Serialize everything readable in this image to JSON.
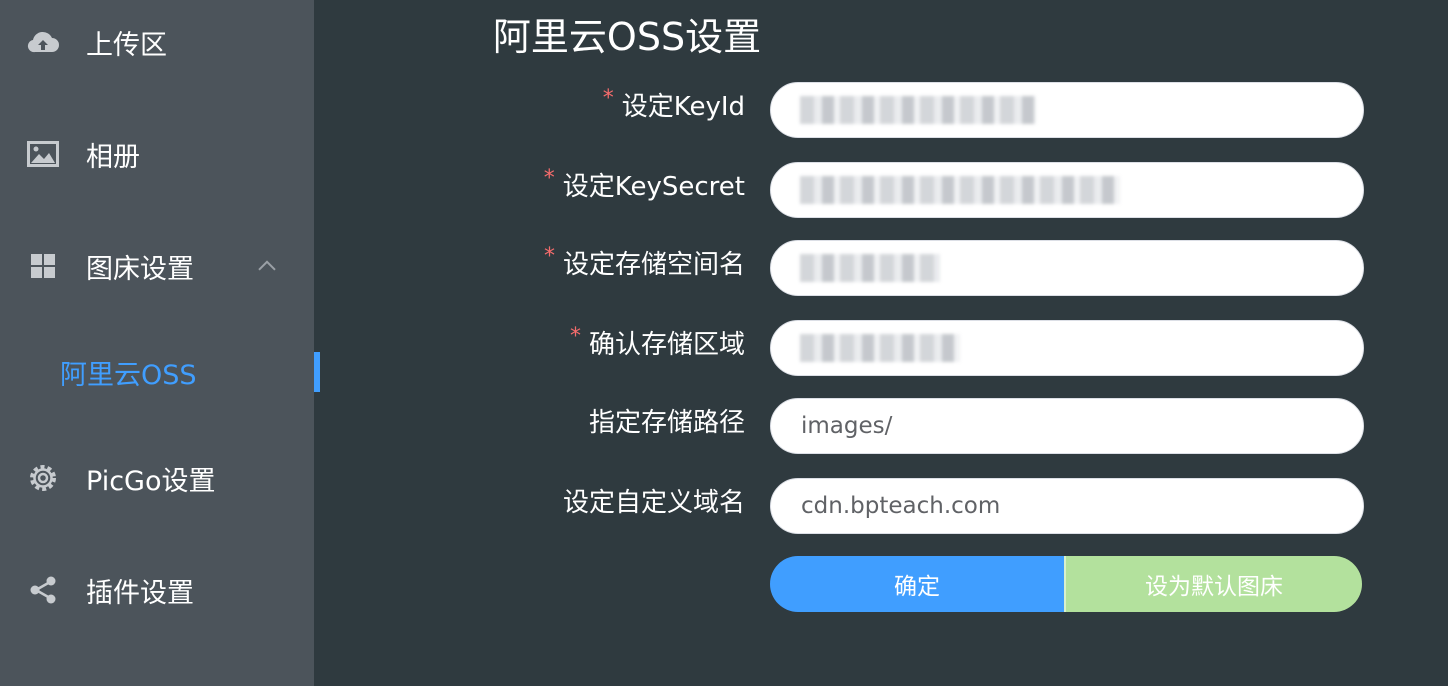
{
  "sidebar": {
    "items": [
      {
        "label": "上传区",
        "icon": "cloud-upload-icon"
      },
      {
        "label": "相册",
        "icon": "image-icon"
      },
      {
        "label": "图床设置",
        "icon": "grid-icon"
      },
      {
        "label": "PicGo设置",
        "icon": "gear-icon"
      },
      {
        "label": "插件设置",
        "icon": "share-icon"
      }
    ],
    "subitem": {
      "label": "阿里云OSS",
      "active": true
    }
  },
  "main": {
    "title": "阿里云OSS设置",
    "fields": [
      {
        "label": "设定KeyId",
        "required": true,
        "value": "LTAI5tMrAB4pNmh7",
        "masked": true
      },
      {
        "label": "设定KeySecret",
        "required": true,
        "value": "••••••••••••••••••••••••••••••",
        "masked": true
      },
      {
        "label": "设定存储空间名",
        "required": true,
        "value": "bp-upload",
        "masked": true
      },
      {
        "label": "确认存储区域",
        "required": true,
        "value": "oss-cn-beijing",
        "masked": true
      },
      {
        "label": "指定存储路径",
        "required": false,
        "value": "images/",
        "masked": false
      },
      {
        "label": "设定自定义域名",
        "required": false,
        "value": "cdn.bpteach.com",
        "masked": false
      }
    ],
    "buttons": {
      "confirm": "确定",
      "set_default": "设为默认图床"
    }
  },
  "colors": {
    "sidebar_bg": "#4c545b",
    "main_bg": "#2f3a3f",
    "accent": "#409eff",
    "required": "#f56c6c",
    "default_button": "#b3e19d"
  }
}
